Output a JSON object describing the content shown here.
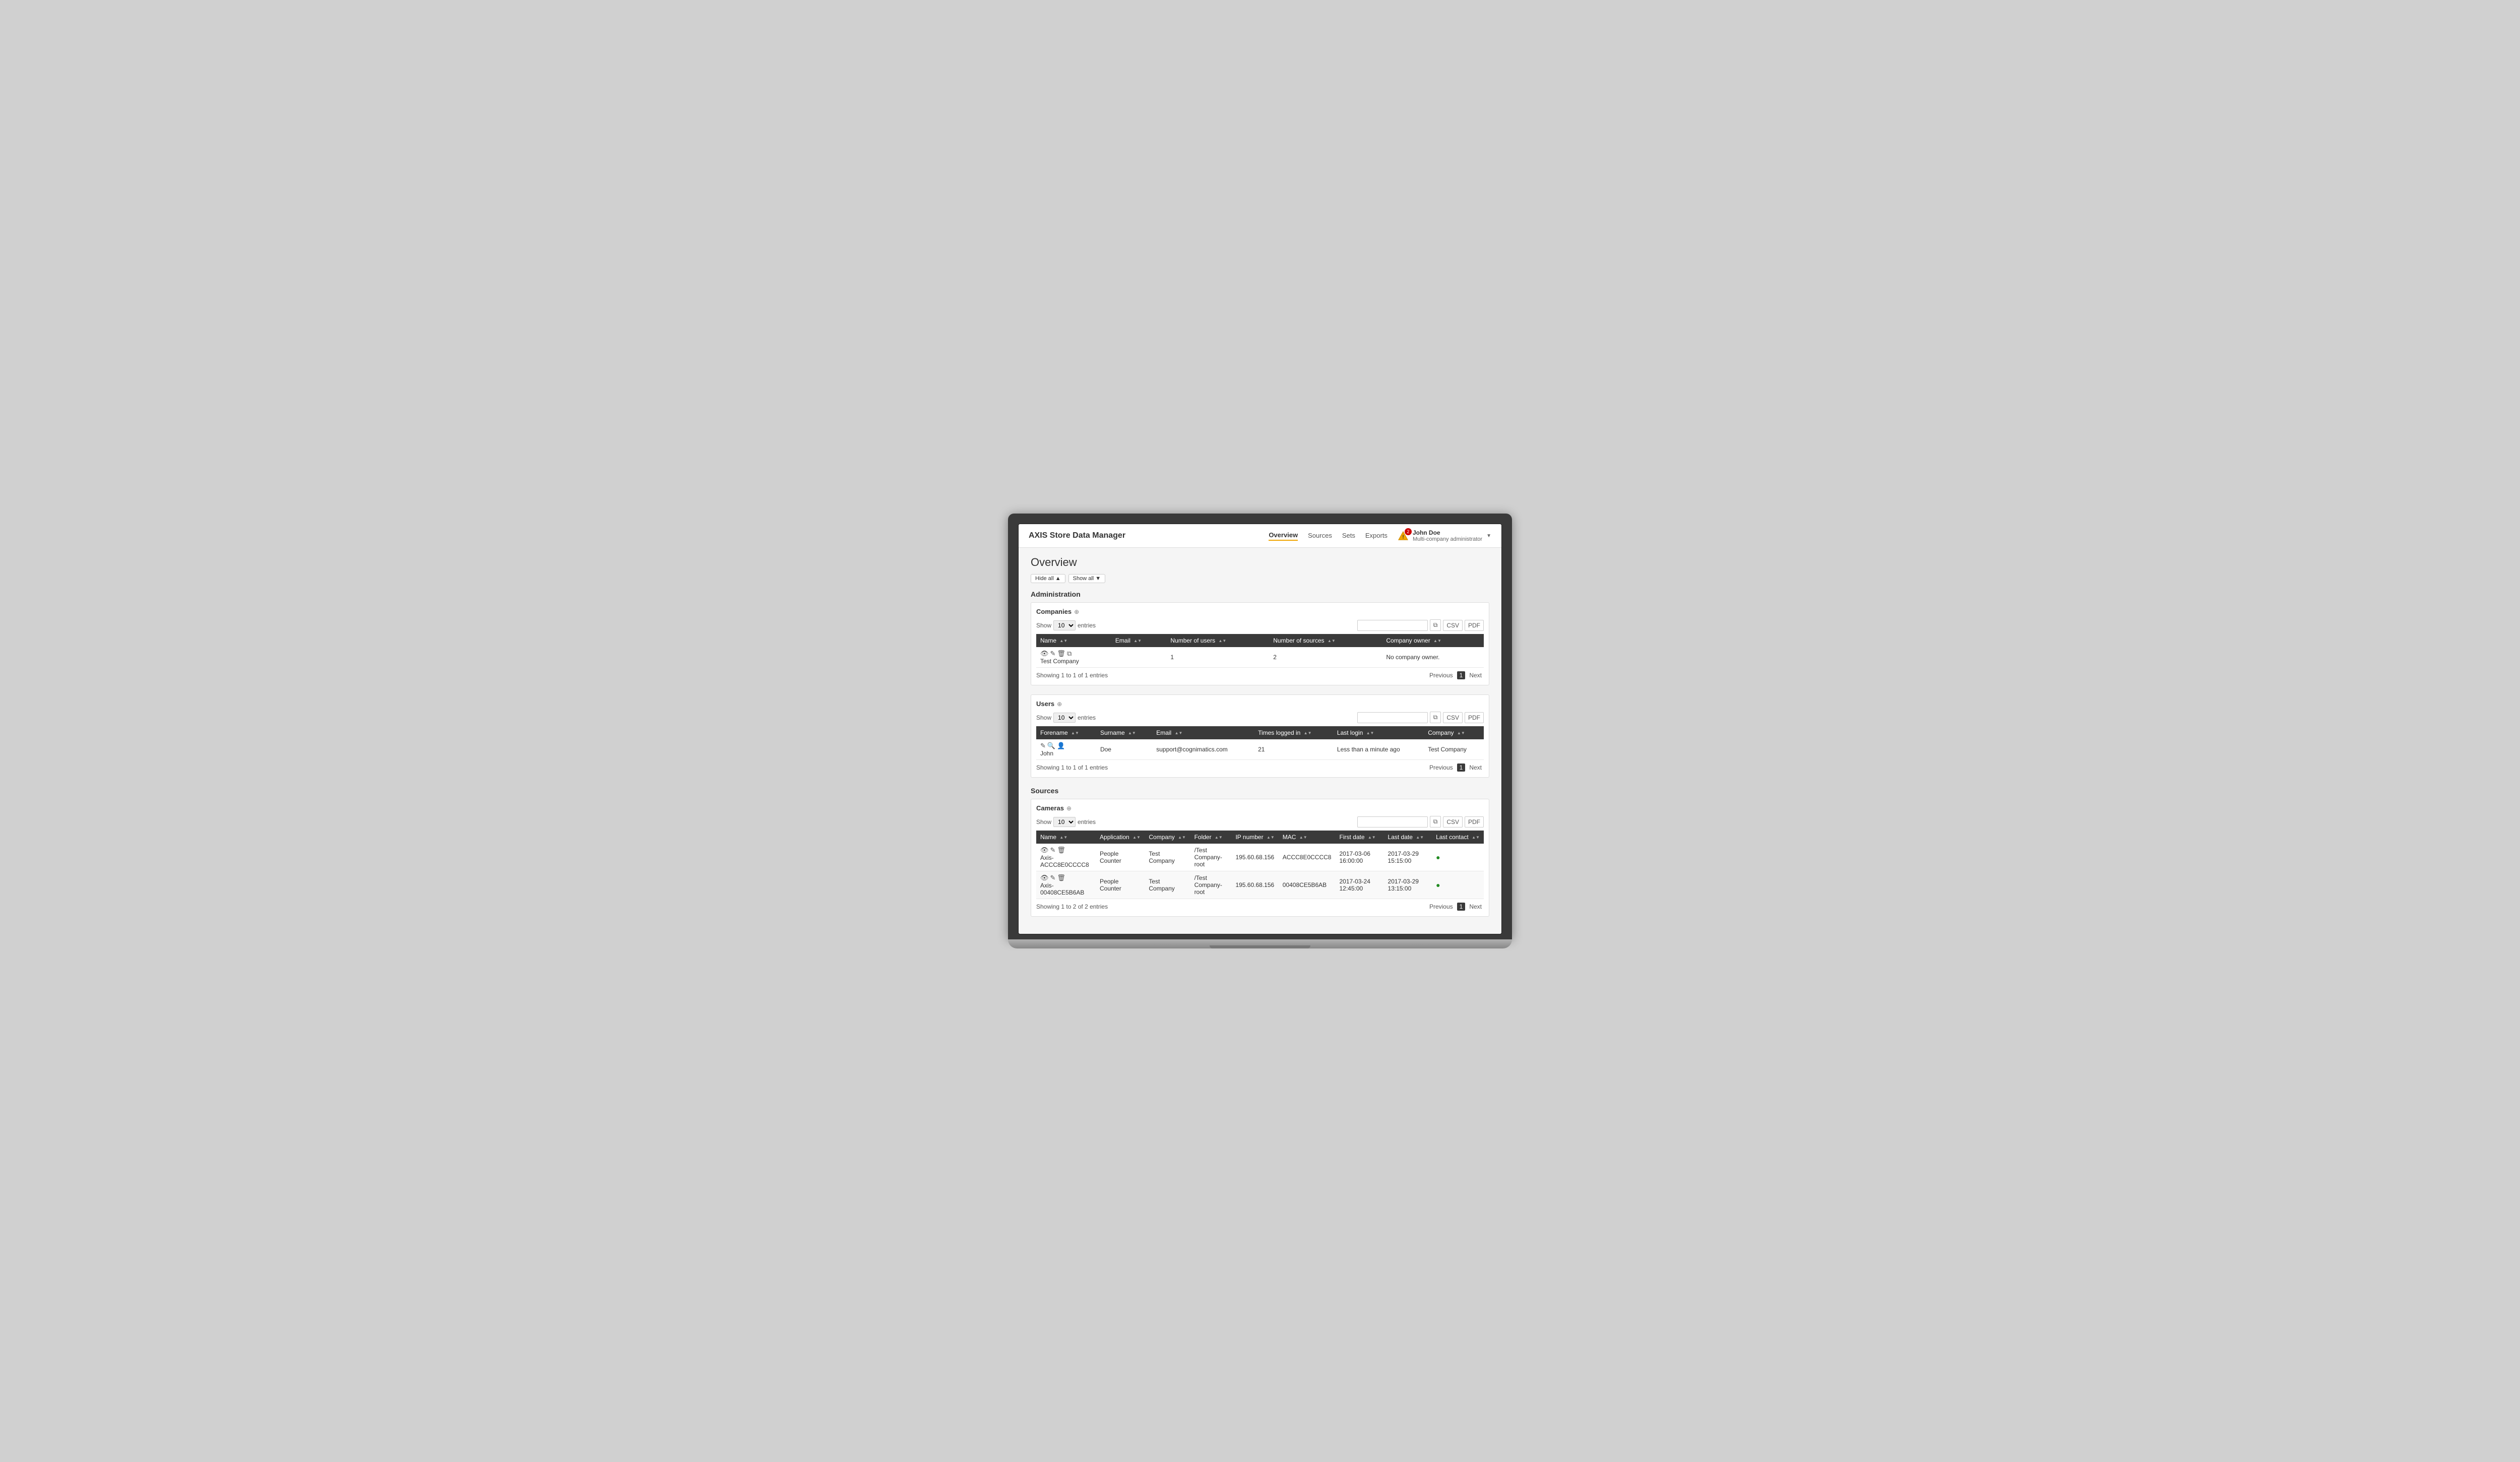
{
  "app": {
    "title": "AXIS Store Data Manager"
  },
  "nav": {
    "links": [
      {
        "label": "Overview",
        "active": true
      },
      {
        "label": "Sources",
        "active": false
      },
      {
        "label": "Sets",
        "active": false
      },
      {
        "label": "Exports",
        "active": false
      }
    ],
    "user": {
      "name": "John Doe",
      "role": "Multi-company administrator",
      "alert_count": "2"
    }
  },
  "page": {
    "title": "Overview",
    "hide_all_label": "Hide all ▲",
    "show_all_label": "Show all ▼"
  },
  "administration": {
    "section_title": "Administration",
    "companies": {
      "subsection_title": "Companies",
      "show_label": "Show",
      "entries_label": "entries",
      "show_value": "10",
      "search_placeholder": "",
      "columns": [
        "Name",
        "Email",
        "Number of users",
        "Number of sources",
        "Company owner"
      ],
      "rows": [
        {
          "name": "Test Company",
          "email": "",
          "num_users": "1",
          "num_sources": "2",
          "company_owner": "No company owner."
        }
      ],
      "showing": "Showing 1 to 1 of 1 entries",
      "prev_label": "Previous",
      "page_num": "1",
      "next_label": "Next"
    },
    "users": {
      "subsection_title": "Users",
      "show_label": "Show",
      "entries_label": "entries",
      "show_value": "10",
      "search_placeholder": "",
      "columns": [
        "Forename",
        "Surname",
        "Email",
        "Times logged in",
        "Last login",
        "Company"
      ],
      "rows": [
        {
          "forename": "John",
          "surname": "Doe",
          "email": "support@cognimatics.com",
          "times_logged_in": "21",
          "last_login": "Less than a minute ago",
          "company": "Test Company"
        }
      ],
      "showing": "Showing 1 to 1 of 1 entries",
      "prev_label": "Previous",
      "page_num": "1",
      "next_label": "Next"
    }
  },
  "sources": {
    "section_title": "Sources",
    "cameras": {
      "subsection_title": "Cameras",
      "show_label": "Show",
      "entries_label": "entries",
      "show_value": "10",
      "search_placeholder": "",
      "columns": [
        "Name",
        "Application",
        "Company",
        "Folder",
        "IP number",
        "MAC",
        "First date",
        "Last date",
        "Last contact"
      ],
      "rows": [
        {
          "name": "Axis-ACCC8E0CCCC8",
          "application": "People Counter",
          "company": "Test Company",
          "folder": "/Test Company-root",
          "ip": "195.60.68.156",
          "mac": "ACCC8E0CCCC8",
          "first_date": "2017-03-06 16:00:00",
          "last_date": "2017-03-29 15:15:00",
          "last_contact_ok": true
        },
        {
          "name": "Axis-00408CE5B6AB",
          "application": "People Counter",
          "company": "Test Company",
          "folder": "/Test Company-root",
          "ip": "195.60.68.156",
          "mac": "00408CE5B6AB",
          "first_date": "2017-03-24 12:45:00",
          "last_date": "2017-03-29 13:15:00",
          "last_contact_ok": true
        }
      ],
      "showing": "Showing 1 to 2 of 2 entries",
      "prev_label": "Previous",
      "page_num": "1",
      "next_label": "Next"
    }
  },
  "icons": {
    "copy": "⧉",
    "csv": "CSV",
    "pdf": "PDF",
    "search": "🔍",
    "view": "👁",
    "edit": "✎",
    "delete": "🗑",
    "camera_icon": "📷",
    "user_icon": "👤",
    "sort_up": "▲",
    "sort_down": "▼",
    "info": "⊕",
    "check": "●",
    "alert": "⚠"
  }
}
